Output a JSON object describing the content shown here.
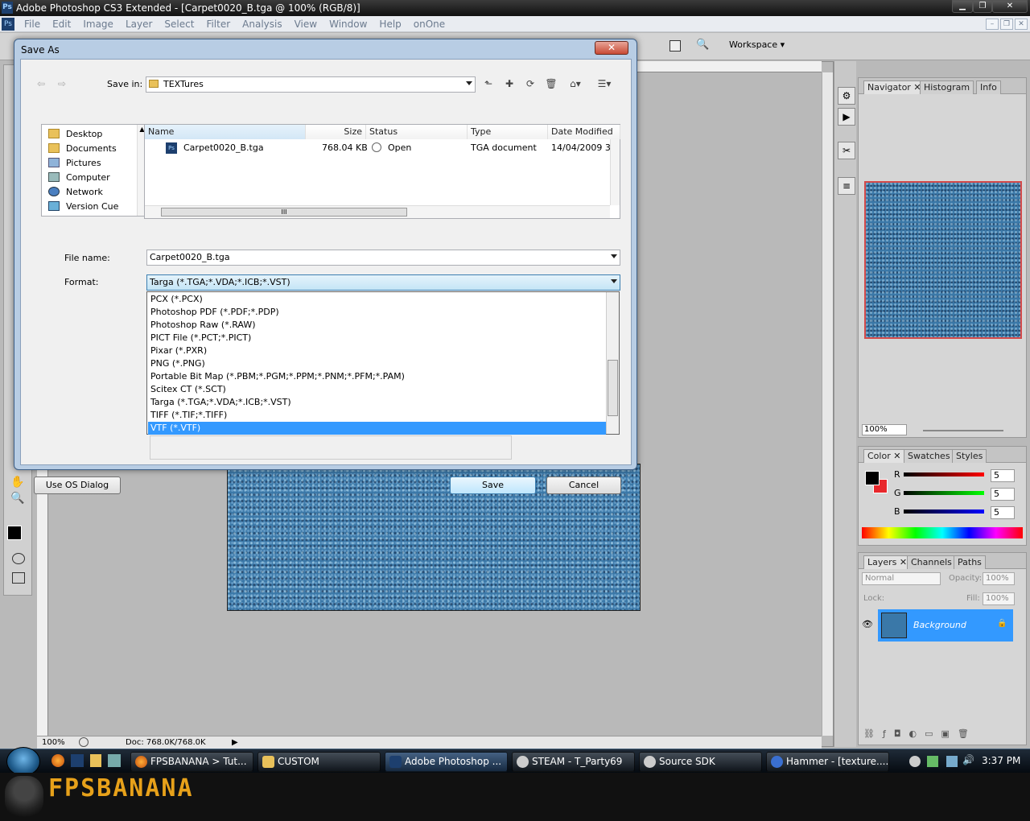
{
  "window": {
    "title": "Adobe Photoshop CS3 Extended - [Carpet0020_B.tga @ 100% (RGB/8)]"
  },
  "menu": [
    "File",
    "Edit",
    "Image",
    "Layer",
    "Select",
    "Filter",
    "Analysis",
    "View",
    "Window",
    "Help",
    "onOne"
  ],
  "optbar": {
    "workspace": "Workspace"
  },
  "doc": {
    "zoom": "100%",
    "doc_size": "Doc: 768.0K/768.0K"
  },
  "dialog": {
    "title": "Save As",
    "save_in_label": "Save in:",
    "save_in_value": "TEXTures",
    "places": [
      "Desktop",
      "Documents",
      "Pictures",
      "Computer",
      "Network",
      "Version Cue"
    ],
    "columns": [
      "Name",
      "Size",
      "Status",
      "Type",
      "Date Modified"
    ],
    "file": {
      "name": "Carpet0020_B.tga",
      "size": "768.04 KB",
      "status": "Open",
      "type": "TGA document",
      "date": "14/04/2009 3:"
    },
    "scroll_mark": "III",
    "file_name_label": "File name:",
    "file_name_value": "Carpet0020_B.tga",
    "format_label": "Format:",
    "format_value": "Targa (*.TGA;*.VDA;*.ICB;*.VST)",
    "format_options": [
      "PCX (*.PCX)",
      "Photoshop PDF (*.PDF;*.PDP)",
      "Photoshop Raw (*.RAW)",
      "PICT File (*.PCT;*.PICT)",
      "Pixar (*.PXR)",
      "PNG (*.PNG)",
      "Portable Bit Map (*.PBM;*.PGM;*.PPM;*.PNM;*.PFM;*.PAM)",
      "Scitex CT (*.SCT)",
      "Targa (*.TGA;*.VDA;*.ICB;*.VST)",
      "TIFF (*.TIF;*.TIFF)",
      "VTF (*.VTF)"
    ],
    "selected_option": 10,
    "use_os_dialog": "Use OS Dialog",
    "save": "Save",
    "cancel": "Cancel"
  },
  "panels": {
    "navigator": {
      "tabs": [
        "Navigator",
        "Histogram",
        "Info"
      ],
      "zoom": "100%"
    },
    "color": {
      "tabs": [
        "Color",
        "Swatches",
        "Styles"
      ],
      "r_label": "R",
      "g_label": "G",
      "b_label": "B",
      "r": "5",
      "g": "5",
      "b": "5"
    },
    "layers": {
      "tabs": [
        "Layers",
        "Channels",
        "Paths"
      ],
      "blend": "Normal",
      "opacity_label": "Opacity:",
      "opacity": "100%",
      "lock_label": "Lock:",
      "fill_label": "Fill:",
      "fill": "100%",
      "layer_name": "Background"
    }
  },
  "taskbar": {
    "items": [
      "FPSBANANA > Tut...",
      "CUSTOM",
      "Adobe Photoshop ...",
      "STEAM - T_Party69",
      "Source SDK",
      "Hammer - [texture...."
    ],
    "clock": "3:37 PM"
  },
  "banner": {
    "text": "FPSBANANA"
  },
  "colors": {
    "selection": "#3399ff",
    "dialog_frame": "#b8cde4",
    "canvas": "#3a78a8",
    "banner": "#e7a11a"
  }
}
